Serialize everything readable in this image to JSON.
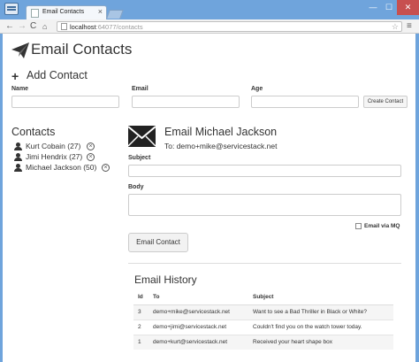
{
  "browser": {
    "tab_title": "Email Contacts",
    "tab_close": "×",
    "url_host": "localhost",
    "url_rest": ":64077/contacts",
    "window_controls": {
      "minimize": "—",
      "maximize": "☐",
      "close": "✕"
    },
    "nav": {
      "back": "←",
      "forward": "→",
      "reload": "C",
      "home": "⌂"
    },
    "star": "☆",
    "menu": "≡"
  },
  "page": {
    "title": "Email Contacts",
    "add_contact": {
      "heading": "Add Contact",
      "name_label": "Name",
      "email_label": "Email",
      "age_label": "Age",
      "name_value": "",
      "email_value": "",
      "age_value": "",
      "create_button": "Create Contact"
    },
    "contacts": {
      "heading": "Contacts",
      "items": [
        {
          "label": "Kurt Cobain (27)"
        },
        {
          "label": "Jimi Hendrix (27)"
        },
        {
          "label": "Michael Jackson (50)"
        }
      ],
      "remove_glyph": "×"
    },
    "email_form": {
      "heading": "Email Michael Jackson",
      "to_line": "To: demo+mike@servicestack.net",
      "subject_label": "Subject",
      "body_label": "Body",
      "subject_value": "",
      "body_value": "",
      "mq_label": "Email via MQ",
      "mq_checked": false,
      "send_button": "Email Contact"
    },
    "history": {
      "heading": "Email History",
      "columns": [
        "Id",
        "To",
        "Subject"
      ],
      "rows": [
        {
          "id": "3",
          "to": "demo+mike@servicestack.net",
          "subject": "Want to see a Bad Thriller in Black or White?"
        },
        {
          "id": "2",
          "to": "demo+jimi@servicestack.net",
          "subject": "Couldn't find you on the watch tower today."
        },
        {
          "id": "1",
          "to": "demo+kurt@servicestack.net",
          "subject": "Received your heart shape box"
        }
      ]
    }
  },
  "colors": {
    "window_frame": "#6fa4dc",
    "close_button": "#c75050",
    "text": "#333333",
    "table_stripe": "#f5f5f5"
  },
  "icons": {
    "title": "paper-plane-icon",
    "add": "plus-icon",
    "contact": "user-icon",
    "remove": "remove-circle-icon",
    "email": "envelope-icon"
  }
}
